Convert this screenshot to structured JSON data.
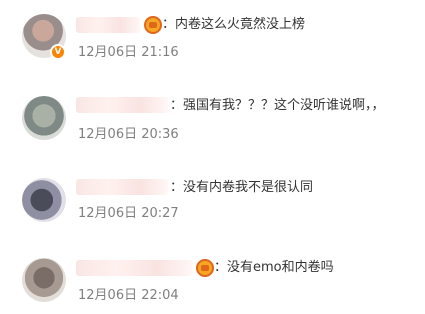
{
  "comments": [
    {
      "text": "：内卷这么火竟然没上榜",
      "time": "12月06日 21:16",
      "avatar_color": "#c9a79b",
      "verified": true,
      "vip": true
    },
    {
      "text": "：强国有我？？？这个没听谁说啊，，",
      "time": "12月06日 20:36",
      "avatar_color": "#a9b1a6",
      "verified": false,
      "vip": false
    },
    {
      "text": "：没有内卷我不是很认同",
      "time": "12月06日 20:27",
      "avatar_color": "#4b4c59",
      "verified": false,
      "vip": false
    },
    {
      "text": "：没有emo和内卷吗",
      "time": "12月06日 22:04",
      "avatar_color": "#7a6c66",
      "verified": false,
      "vip": true
    }
  ],
  "colors": {
    "text": "#333333",
    "timestamp": "#808080",
    "verified_badge": "#ff8200",
    "vip_badge": "#f5a623"
  },
  "icons": {
    "verified": "verified-v-icon",
    "vip": "vip-crown-icon"
  }
}
